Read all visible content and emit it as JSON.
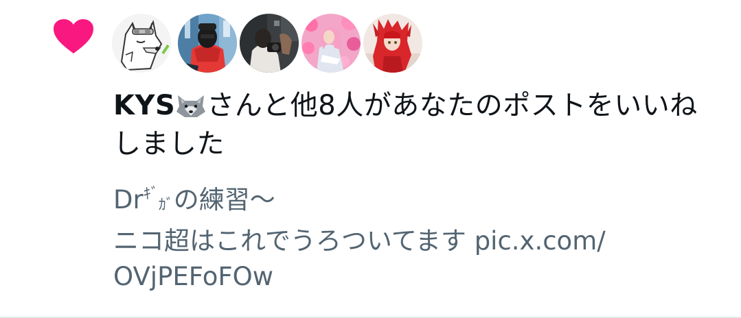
{
  "notification": {
    "headline": {
      "actor": "KYS",
      "actor_emoji": "wolf-emoji",
      "line1_rest": "さんと他8人があなたのポストをいいね",
      "line2": "しました"
    },
    "post_text": {
      "line1_prefix": "Dr",
      "line1_small_gi": "ｷﾞ",
      "line1_small_ga": "ｶﾞ",
      "line1_rest": "の練習〜",
      "line2": "ニコ超はこれでうろついてます pic.x.com/",
      "line3": "OVjPEFoFOw"
    },
    "icon": "heart-icon",
    "avatars": [
      "wolf-drawing-avatar",
      "red-hoodie-avatar",
      "camera-photo-avatar",
      "pink-hair-avatar",
      "red-hair-avatar"
    ]
  },
  "colors": {
    "heart": "#f91880",
    "primary_text": "#0f1419",
    "secondary_text": "#536471",
    "divider": "#e6e9ec"
  }
}
